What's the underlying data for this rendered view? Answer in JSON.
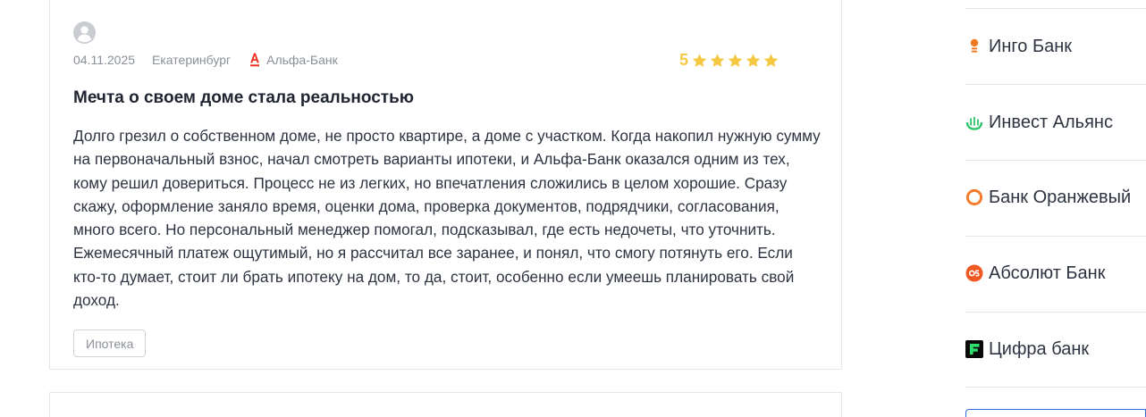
{
  "review": {
    "date": "04.11.2025",
    "city": "Екатеринбург",
    "bank": "Альфа-Банк",
    "rating": "5",
    "stars": 5,
    "title": "Мечта о своем доме стала реальностью",
    "text": "Долго грезил о собственном доме, не просто квартире, а доме с участком. Когда накопил нужную сумму на первоначальный взнос, начал смотреть варианты ипотеки, и Альфа-Банк оказался одним из тех, кому решил довериться. Процесс не из легких, но впечатления сложились в целом хорошие. Сразу скажу, оформление заняло время, оценки дома, проверка документов, подрядчики, согласования, много всего. Но персональный менеджер помогал, подсказывал, где есть недочеты, что уточнить. Ежемесячный платеж ощутимый, но я рассчитал все заранее, и понял, что смогу потянуть его. Если кто-то думает, стоит ли брать ипотеку на дом, то да, стоит, особенно если умеешь планировать свой доход.",
    "tag": "Ипотека"
  },
  "sidebar": {
    "banks": [
      {
        "name": "Инго Банк",
        "icon": "ingo-bank-logo-icon",
        "color": "#f07a21"
      },
      {
        "name": "Инвест Альянс",
        "icon": "invest-alliance-logo-icon",
        "color": "#2cc46a"
      },
      {
        "name": "Банк Оранжевый",
        "icon": "orange-bank-logo-icon",
        "color": "#f47c2c"
      },
      {
        "name": "Абсолют Банк",
        "icon": "absolut-bank-logo-icon",
        "color": "#f05a22"
      },
      {
        "name": "Цифра банк",
        "icon": "cifra-bank-logo-icon",
        "color": "#0a0a0a"
      }
    ]
  },
  "colors": {
    "star": "#f5c842",
    "alfa_red": "#ef3124",
    "muted_text": "#8a8f99",
    "border": "#e6e8ec"
  }
}
